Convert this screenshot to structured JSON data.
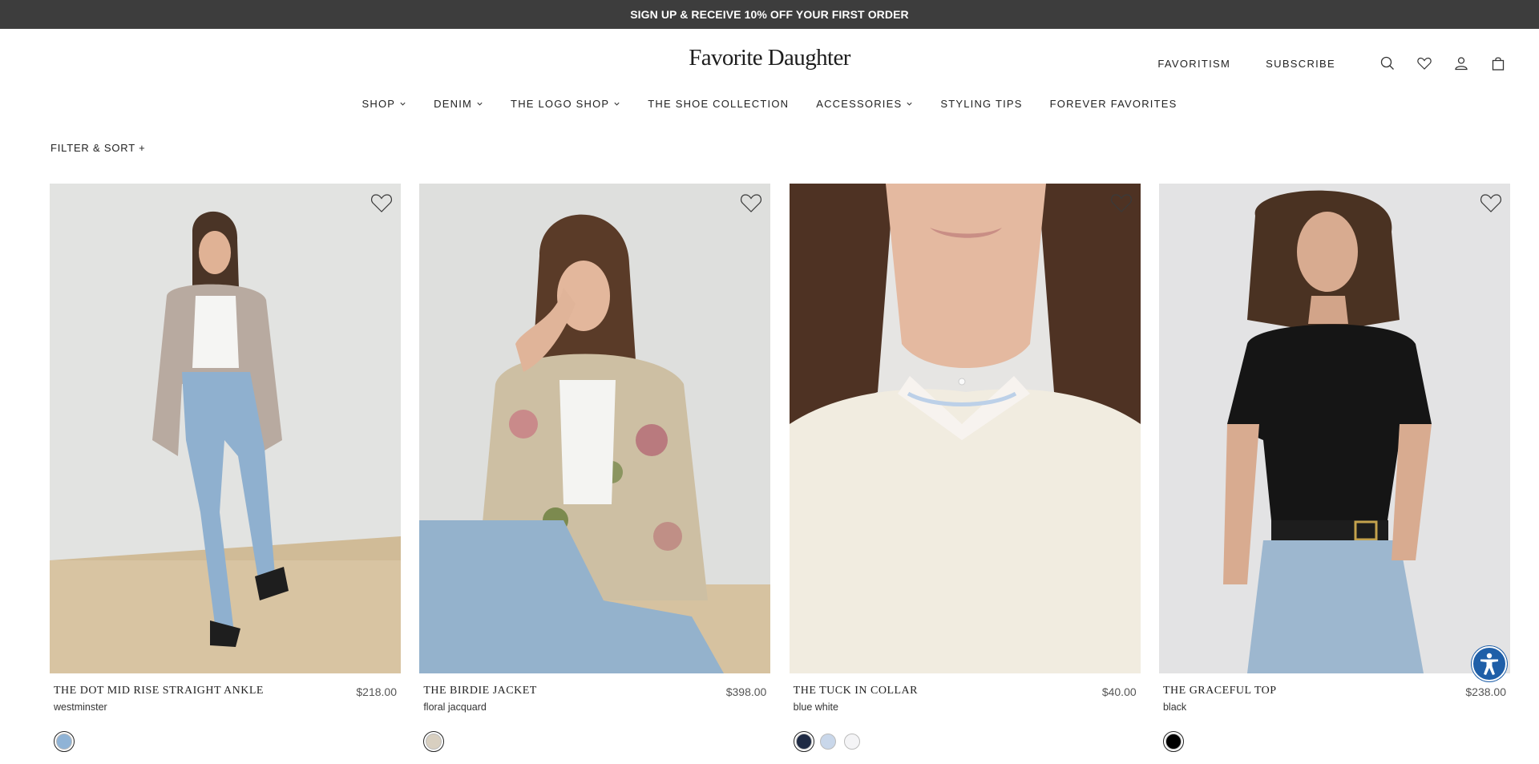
{
  "promo": {
    "text": "SIGN UP & RECEIVE 10% OFF YOUR FIRST ORDER"
  },
  "header": {
    "logo": "Favorite Daughter",
    "util_links": [
      "FAVORITISM",
      "SUBSCRIBE"
    ],
    "icons": [
      "search-icon",
      "heart-icon",
      "user-icon",
      "bag-icon"
    ]
  },
  "nav": {
    "items": [
      {
        "label": "SHOP",
        "has_dropdown": true
      },
      {
        "label": "DENIM",
        "has_dropdown": true
      },
      {
        "label": "THE LOGO SHOP",
        "has_dropdown": true
      },
      {
        "label": "THE SHOE COLLECTION",
        "has_dropdown": false
      },
      {
        "label": "ACCESSORIES",
        "has_dropdown": true
      },
      {
        "label": "STYLING TIPS",
        "has_dropdown": false
      },
      {
        "label": "FOREVER FAVORITES",
        "has_dropdown": false
      }
    ]
  },
  "filter": {
    "label": "FILTER & SORT +"
  },
  "products": [
    {
      "name": "THE DOT MID RISE STRAIGHT ANKLE",
      "color": "westminster",
      "price": "$218.00",
      "swatches": [
        "#8fb3d6"
      ]
    },
    {
      "name": "THE BIRDIE JACKET",
      "color": "floral jacquard",
      "price": "$398.00",
      "swatches": [
        "#d8cfc0"
      ]
    },
    {
      "name": "THE TUCK IN COLLAR",
      "color": "blue white",
      "price": "$40.00",
      "swatches": [
        "#1e2a44",
        "#c9d7ea",
        "#f4f4f6"
      ]
    },
    {
      "name": "THE GRACEFUL TOP",
      "color": "black",
      "price": "$238.00",
      "swatches": [
        "#000000"
      ]
    }
  ],
  "colors": {
    "promo_bg": "#3d3d3d",
    "accessibility": "#1f5fa8"
  }
}
